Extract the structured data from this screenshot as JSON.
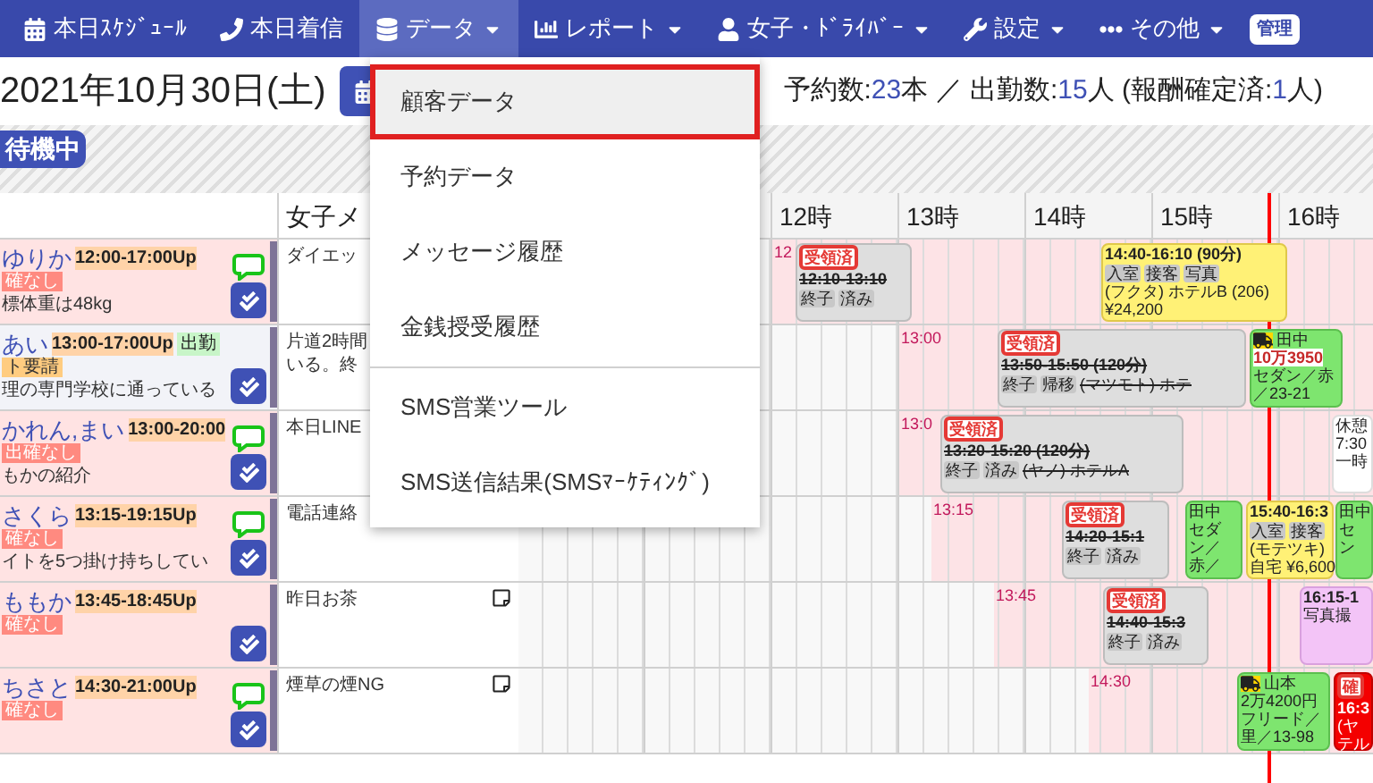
{
  "nav": {
    "items": [
      {
        "label": "本日ｽｹｼﾞｭｰﾙ",
        "has_menu": false,
        "selected": false
      },
      {
        "label": "本日着信",
        "has_menu": false,
        "selected": false
      },
      {
        "label": "データ",
        "has_menu": true,
        "selected": true
      },
      {
        "label": "レポート",
        "has_menu": true,
        "selected": false
      },
      {
        "label": "女子・ﾄﾞﾗｲﾊﾞｰ",
        "has_menu": true,
        "selected": false
      },
      {
        "label": "設定",
        "has_menu": true,
        "selected": false
      },
      {
        "label": "その他",
        "has_menu": true,
        "selected": false
      }
    ],
    "user_badge": "管理"
  },
  "dropdown": {
    "items": [
      {
        "label": "顧客データ",
        "selected": true,
        "divider_before": false
      },
      {
        "label": "予約データ",
        "selected": false,
        "divider_before": false
      },
      {
        "label": "メッセージ履歴",
        "selected": false,
        "divider_before": false
      },
      {
        "label": "金銭授受履歴",
        "selected": false,
        "divider_before": false
      },
      {
        "label": "SMS営業ツール",
        "selected": false,
        "divider_before": true
      },
      {
        "label": "SMS送信結果(SMSﾏｰｹﾃｨﾝｸﾞ)",
        "selected": false,
        "divider_before": false
      }
    ]
  },
  "date": "2021年10月30日(土)",
  "summary": {
    "bookings_label": "予約数:",
    "bookings": "23",
    "bookings_unit": "本",
    "separator": "／",
    "staff_label": "出勤数:",
    "staff": "15",
    "staff_unit": "人",
    "paid_label": "(報酬確定済:",
    "paid": "1",
    "paid_unit": "人)"
  },
  "waiting_badge": "待機中",
  "table": {
    "memo_header": "女子メ",
    "hours": [
      "12時",
      "13時",
      "14時",
      "15時",
      "16時"
    ],
    "rows": [
      {
        "name": "ゆりか",
        "time": "12:00-17:00Up",
        "on_duty": false,
        "tag": {
          "text": "確なし",
          "kind": "warning"
        },
        "note": "標体重は48kg",
        "line": true,
        "memo_lines": [
          "ダイエッ"
        ],
        "memo_icon": false,
        "start_label": "12",
        "bookings": [
          {
            "kind": "received",
            "badge": "受領済",
            "time": "12:10-13:10",
            "tags": [
              "終子",
              "済み"
            ]
          },
          {
            "kind": "confirmed",
            "time": "14:40-16:10 (90分)",
            "tags": [
              "入室",
              "接客",
              "写真"
            ],
            "lines": [
              "(フクタ) ホテルB (206)",
              "¥24,200"
            ]
          }
        ]
      },
      {
        "name": "あい",
        "time": "13:00-17:00Up",
        "badge": "出勤",
        "on_duty": true,
        "tag": {
          "text": "ト要請",
          "kind": "request"
        },
        "note": "理の専門学校に通っている",
        "line": false,
        "memo_lines": [
          "片道2時間",
          "いる。終"
        ],
        "memo_icon": false,
        "start_label": "13:00",
        "bookings": [
          {
            "kind": "received",
            "badge": "受領済",
            "time": "13:50-15:50 (120分)",
            "tags": [
              "終子",
              "帰移"
            ],
            "tag_note": "(マツモト) ホテ"
          },
          {
            "kind": "driver",
            "truck": true,
            "driver": "田中",
            "amount": "10万3950",
            "lines": [
              "セダン／赤",
              "／23-21"
            ]
          }
        ]
      },
      {
        "name": "かれん,まい",
        "time": "13:00-20:00",
        "on_duty": false,
        "tag": {
          "text": "出確なし",
          "kind": "warning"
        },
        "note": "もかの紹介",
        "line": true,
        "memo_lines": [
          "本日LINE"
        ],
        "memo_icon": false,
        "start_label": "13:0",
        "bookings": [
          {
            "kind": "received",
            "badge": "受領済",
            "time": "13:20-15:20 (120分)",
            "tags": [
              "終子",
              "済み"
            ],
            "tag_note": "(ヤノ) ホテルA"
          },
          {
            "kind": "break",
            "lines": [
              "休憩",
              "7:30",
              "一時"
            ]
          }
        ]
      },
      {
        "name": "さくら",
        "time": "13:15-19:15Up",
        "on_duty": false,
        "tag": {
          "text": "確なし",
          "kind": "warning"
        },
        "note": "イトを5つ掛け持ちしてい",
        "line": true,
        "memo_lines": [
          "電話連絡"
        ],
        "memo_icon": false,
        "start_label": "13:15",
        "bookings": [
          {
            "kind": "received",
            "badge": "受領済",
            "time": "14:20-15:1",
            "tags": [
              "終子",
              "済み"
            ]
          },
          {
            "kind": "driver",
            "truck": false,
            "driver": "田中",
            "lines": [
              "セダ",
              "ン／",
              "赤／"
            ]
          },
          {
            "kind": "confirmed",
            "time": "15:40-16:3",
            "tags": [
              "入室",
              "接客"
            ],
            "lines": [
              "(モテツキ)",
              "自宅 ¥6,600"
            ]
          },
          {
            "kind": "driver",
            "truck": false,
            "driver": "田中",
            "lines": [
              "セ",
              "ン"
            ]
          }
        ]
      },
      {
        "name": "ももか",
        "time": "13:45-18:45Up",
        "on_duty": false,
        "tag": {
          "text": "確なし",
          "kind": "warning"
        },
        "line": false,
        "memo_lines": [
          "昨日お茶"
        ],
        "memo_icon": true,
        "start_label": "13:45",
        "bookings": [
          {
            "kind": "received",
            "badge": "受領済",
            "time": "14:40-15:3",
            "tags": [
              "終子",
              "済み"
            ]
          },
          {
            "kind": "photo",
            "time": "16:15-1",
            "lines": [
              "写真撮"
            ]
          }
        ]
      },
      {
        "name": "ちさと",
        "time": "14:30-21:00Up",
        "on_duty": false,
        "tag": {
          "text": "確なし",
          "kind": "warning"
        },
        "line": true,
        "memo_lines": [
          "煙草の煙NG"
        ],
        "memo_icon": true,
        "start_label": "14:30",
        "bookings": [
          {
            "kind": "driver",
            "truck": true,
            "driver": "山本",
            "lines": [
              "2万4200円",
              "フリード／",
              "里／13-98"
            ]
          },
          {
            "kind": "pending",
            "time": "16:3",
            "badge": "確",
            "lines": [
              "(ヤ",
              "テル"
            ]
          }
        ]
      }
    ]
  }
}
